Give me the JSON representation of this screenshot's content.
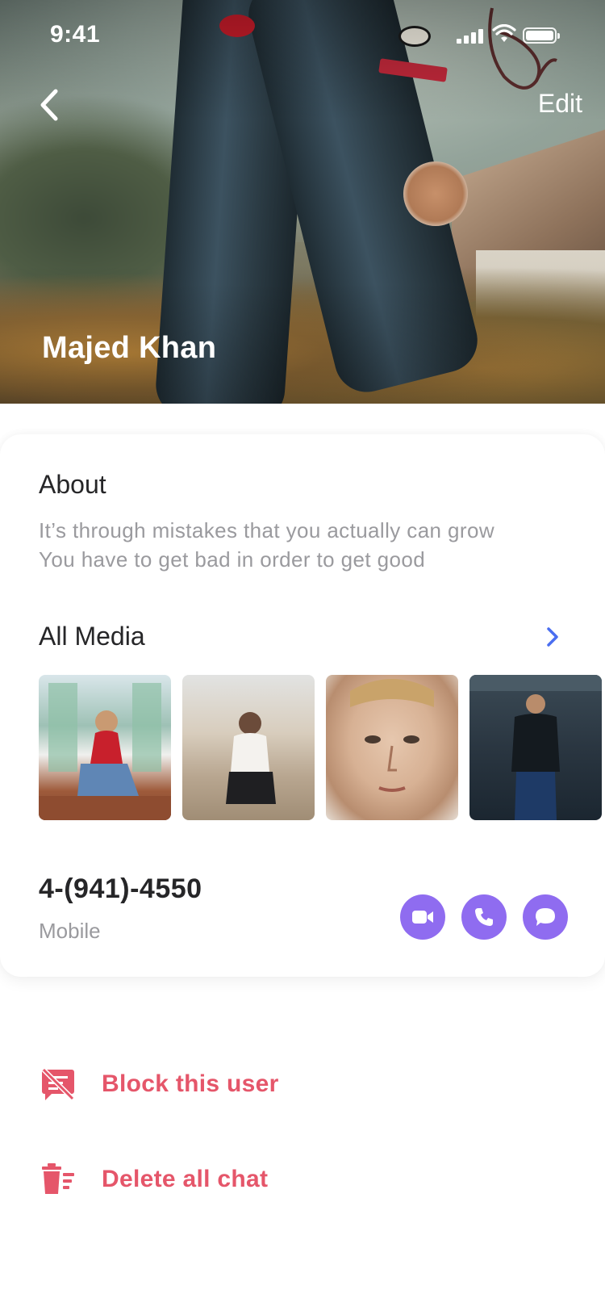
{
  "status_bar": {
    "time": "9:41"
  },
  "header": {
    "edit_label": "Edit",
    "profile_name": "Majed Khan"
  },
  "about": {
    "title": "About",
    "lines": [
      "It’s through mistakes that you actually can grow",
      "You have to get bad in order to get good"
    ]
  },
  "media": {
    "title": "All Media",
    "thumbnail_count": 4
  },
  "contact": {
    "phone": "4-(941)-4550",
    "type": "Mobile",
    "actions": [
      "video-call-icon",
      "phone-icon",
      "message-icon"
    ]
  },
  "actions": {
    "block_label": "Block this user",
    "delete_label": "Delete all chat"
  },
  "colors": {
    "accent": "#8f6cf0",
    "danger": "#e5566a",
    "link": "#4a6ef0",
    "text_primary": "#262628",
    "text_secondary": "#9a9a9e"
  }
}
